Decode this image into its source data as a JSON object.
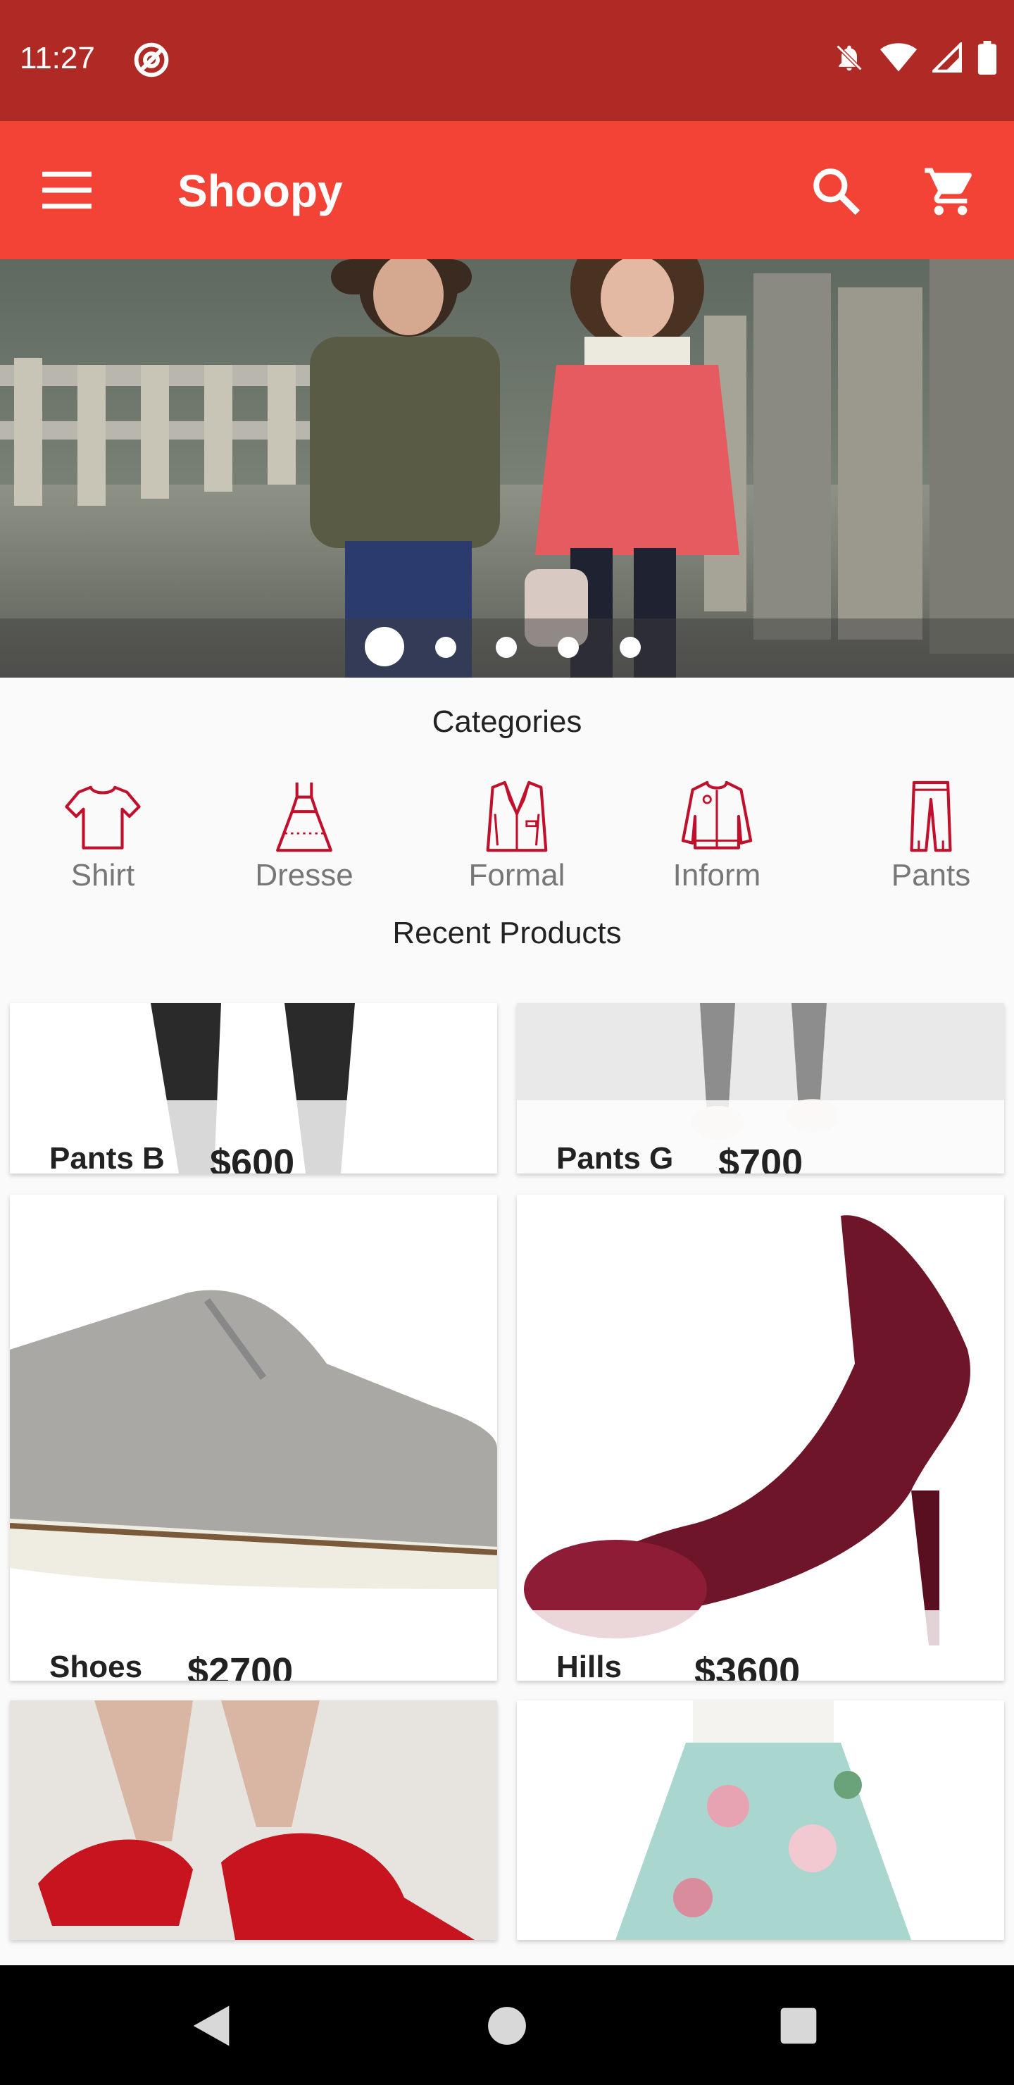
{
  "status_bar": {
    "time": "11:27",
    "icons": [
      "at-sign-icon",
      "notifications-off-icon",
      "wifi-icon",
      "signal-icon",
      "battery-icon"
    ],
    "background": "#b02a25"
  },
  "app_bar": {
    "title": "Shoopy",
    "background": "#f34336",
    "icons": [
      "menu-icon",
      "search-icon",
      "cart-icon"
    ]
  },
  "banner": {
    "active_slide": 1,
    "slide_count": 5
  },
  "categories_section": {
    "title": "Categories",
    "items": [
      {
        "label": "Shirt",
        "icon": "shirt-icon"
      },
      {
        "label": "Dresse",
        "icon": "dress-icon"
      },
      {
        "label": "Formal",
        "icon": "blazer-icon"
      },
      {
        "label": "Inform",
        "icon": "jacket-icon"
      },
      {
        "label": "Pants",
        "icon": "pants-icon"
      }
    ]
  },
  "recent_section": {
    "title": "Recent Products",
    "products": [
      {
        "name": "Pants B",
        "price": "$600"
      },
      {
        "name": "Pants G",
        "price": "$700"
      },
      {
        "name": "Shoes",
        "price": "$2700"
      },
      {
        "name": "Hills",
        "price": "$3600"
      },
      {
        "name": "",
        "price": ""
      },
      {
        "name": "",
        "price": ""
      }
    ]
  },
  "nav_bar": {
    "icons": [
      "back-icon",
      "home-icon",
      "recents-icon"
    ]
  },
  "accent_color": "#c0102b"
}
